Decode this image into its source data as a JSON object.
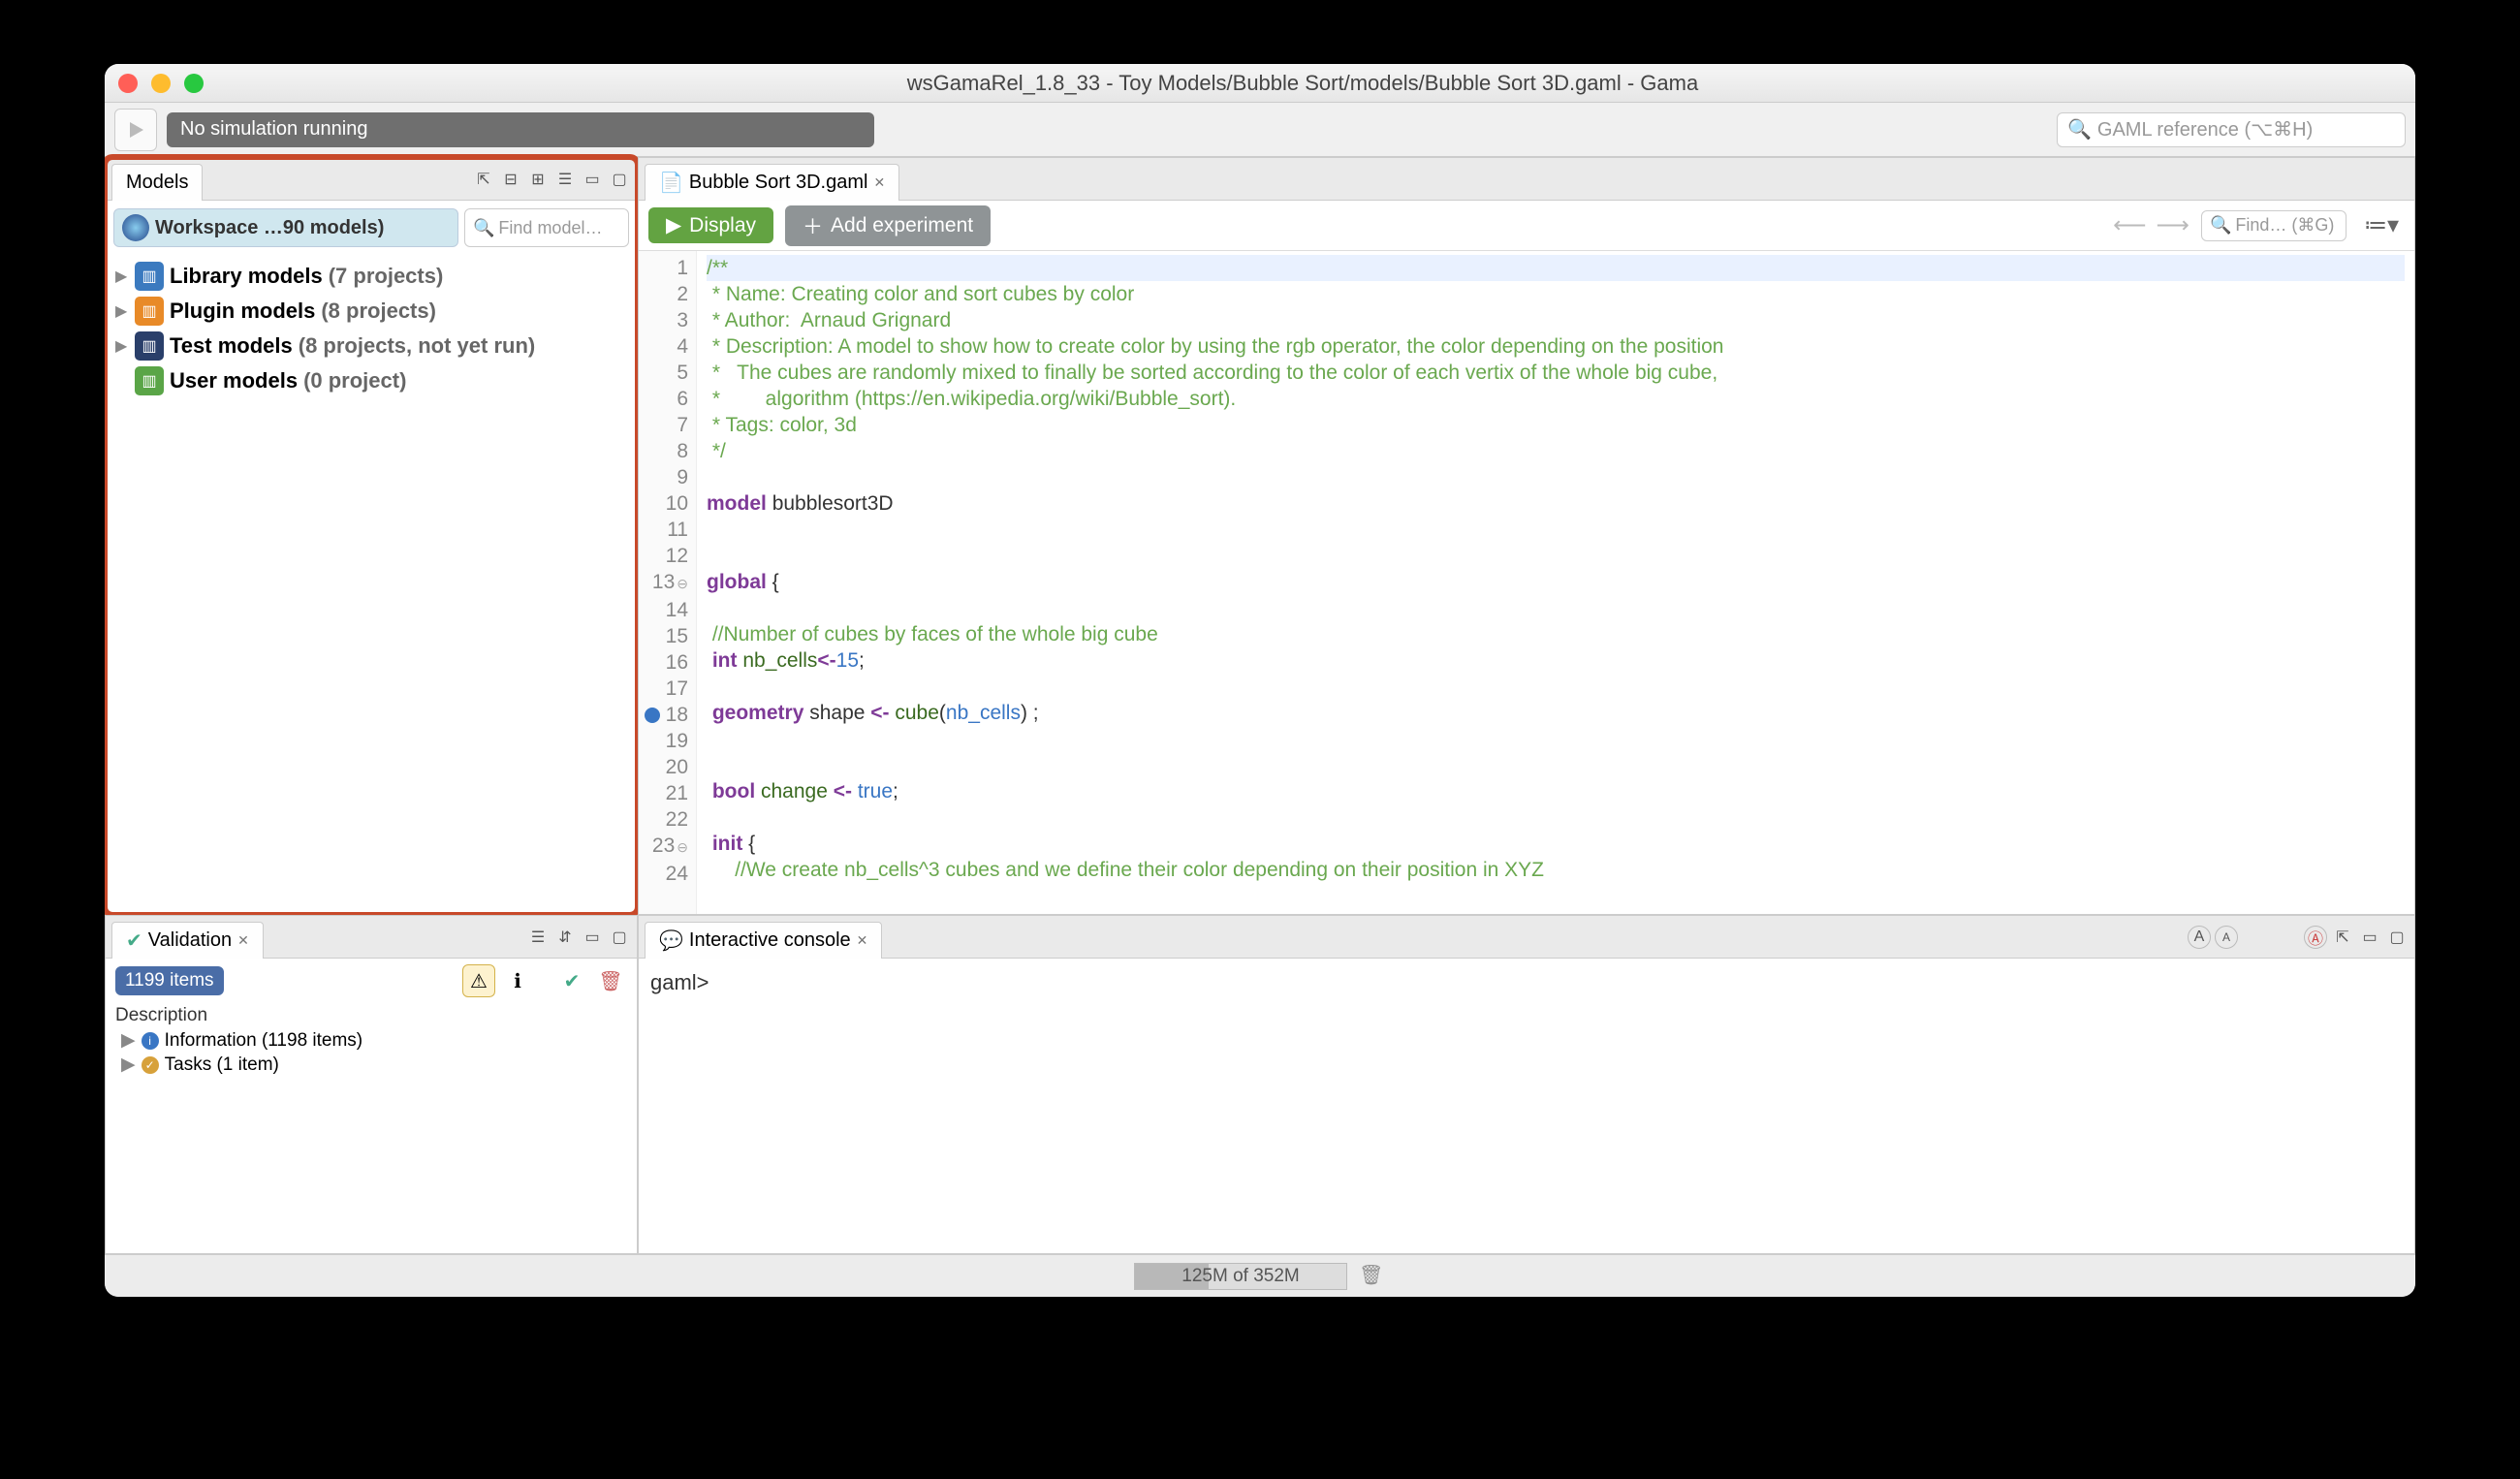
{
  "window": {
    "title": "wsGamaRel_1.8_33 - Toy Models/Bubble Sort/models/Bubble Sort 3D.gaml - Gama"
  },
  "toolbar": {
    "sim_status": "No simulation running",
    "search_ref_placeholder": "GAML reference (⌥⌘H)"
  },
  "models_panel": {
    "tab_label": "Models",
    "workspace_label": "Workspace …90 models)",
    "find_placeholder": "Find model…",
    "tree": [
      {
        "icon": "blue",
        "label": "Library models",
        "suffix": "(7 projects)",
        "expandable": true
      },
      {
        "icon": "orange",
        "label": "Plugin models",
        "suffix": "(8 projects)",
        "expandable": true
      },
      {
        "icon": "navy",
        "label": "Test models",
        "suffix": "(8 projects, not yet run)",
        "expandable": true
      },
      {
        "icon": "green",
        "label": "User models",
        "suffix": "(0 project)",
        "expandable": false
      }
    ]
  },
  "editor": {
    "tab_label": "Bubble Sort 3D.gaml",
    "display_btn": "Display",
    "add_exp_btn": "Add experiment",
    "find_placeholder": "Find… (⌘G)",
    "gutter_breakpoint_line": 18,
    "gutter_fold_lines": [
      13,
      23
    ],
    "lines": [
      {
        "n": 1,
        "tokens": [
          [
            "c-comment",
            "/**"
          ]
        ]
      },
      {
        "n": 2,
        "tokens": [
          [
            "c-comment",
            " * Name: Creating color and sort cubes by color"
          ]
        ]
      },
      {
        "n": 3,
        "tokens": [
          [
            "c-comment",
            " * Author:  Arnaud Grignard"
          ]
        ]
      },
      {
        "n": 4,
        "tokens": [
          [
            "c-comment",
            " * Description: A model to show how to create color by using the rgb operator, the color depending on the position "
          ]
        ]
      },
      {
        "n": 5,
        "tokens": [
          [
            "c-comment",
            " *   The cubes are randomly mixed to finally be sorted according to the color of each vertix of the whole big cube,"
          ]
        ]
      },
      {
        "n": 6,
        "tokens": [
          [
            "c-comment",
            " *        algorithm (https://en.wikipedia.org/wiki/Bubble_sort)."
          ]
        ]
      },
      {
        "n": 7,
        "tokens": [
          [
            "c-comment",
            " * Tags: color, 3d"
          ]
        ]
      },
      {
        "n": 8,
        "tokens": [
          [
            "c-comment",
            " */"
          ]
        ]
      },
      {
        "n": 9,
        "tokens": [
          [
            "",
            ""
          ]
        ]
      },
      {
        "n": 10,
        "tokens": [
          [
            "c-kw",
            "model "
          ],
          [
            "",
            "bubblesort3D"
          ]
        ]
      },
      {
        "n": 11,
        "tokens": [
          [
            "",
            ""
          ]
        ]
      },
      {
        "n": 12,
        "tokens": [
          [
            "",
            ""
          ]
        ]
      },
      {
        "n": 13,
        "tokens": [
          [
            "c-kw",
            "global"
          ],
          [
            "",
            " {"
          ]
        ]
      },
      {
        "n": 14,
        "tokens": [
          [
            "",
            ""
          ]
        ]
      },
      {
        "n": 15,
        "tokens": [
          [
            "c-comment",
            " //Number of cubes by faces of the whole big cube"
          ]
        ]
      },
      {
        "n": 16,
        "tokens": [
          [
            "",
            " "
          ],
          [
            "c-kw",
            "int "
          ],
          [
            "c-fn",
            "nb_cells"
          ],
          [
            "c-kw",
            "<-"
          ],
          [
            "c-lit",
            "15"
          ],
          [
            "",
            ";"
          ]
        ]
      },
      {
        "n": 17,
        "tokens": [
          [
            "",
            ""
          ]
        ]
      },
      {
        "n": 18,
        "tokens": [
          [
            "",
            " "
          ],
          [
            "c-kw",
            "geometry "
          ],
          [
            "",
            "shape "
          ],
          [
            "c-kw",
            "<- "
          ],
          [
            "c-fn",
            "cube"
          ],
          [
            "",
            "("
          ],
          [
            "c-str",
            "nb_cells"
          ],
          [
            "",
            ") ;"
          ]
        ]
      },
      {
        "n": 19,
        "tokens": [
          [
            "",
            ""
          ]
        ]
      },
      {
        "n": 20,
        "tokens": [
          [
            "",
            ""
          ]
        ]
      },
      {
        "n": 21,
        "tokens": [
          [
            "",
            " "
          ],
          [
            "c-kw",
            "bool "
          ],
          [
            "c-fn",
            "change"
          ],
          [
            "",
            " "
          ],
          [
            "c-kw",
            "<- "
          ],
          [
            "c-lit",
            "true"
          ],
          [
            "",
            ";"
          ]
        ]
      },
      {
        "n": 22,
        "tokens": [
          [
            "",
            ""
          ]
        ]
      },
      {
        "n": 23,
        "tokens": [
          [
            "",
            " "
          ],
          [
            "c-kw",
            "init"
          ],
          [
            "",
            " {"
          ]
        ]
      },
      {
        "n": 24,
        "tokens": [
          [
            "",
            "     "
          ],
          [
            "c-comment",
            "//We create nb_cells^3 cubes and we define their color depending on their position in XYZ"
          ]
        ]
      }
    ]
  },
  "validation": {
    "tab_label": "Validation",
    "items_pill": "1199 items",
    "desc_header": "Description",
    "rows": [
      {
        "kind": "info",
        "label": "Information (1198 items)"
      },
      {
        "kind": "task",
        "label": "Tasks (1 item)"
      }
    ]
  },
  "console": {
    "tab_label": "Interactive console",
    "prompt": "gaml>"
  },
  "status": {
    "memory": "125M of 352M"
  }
}
